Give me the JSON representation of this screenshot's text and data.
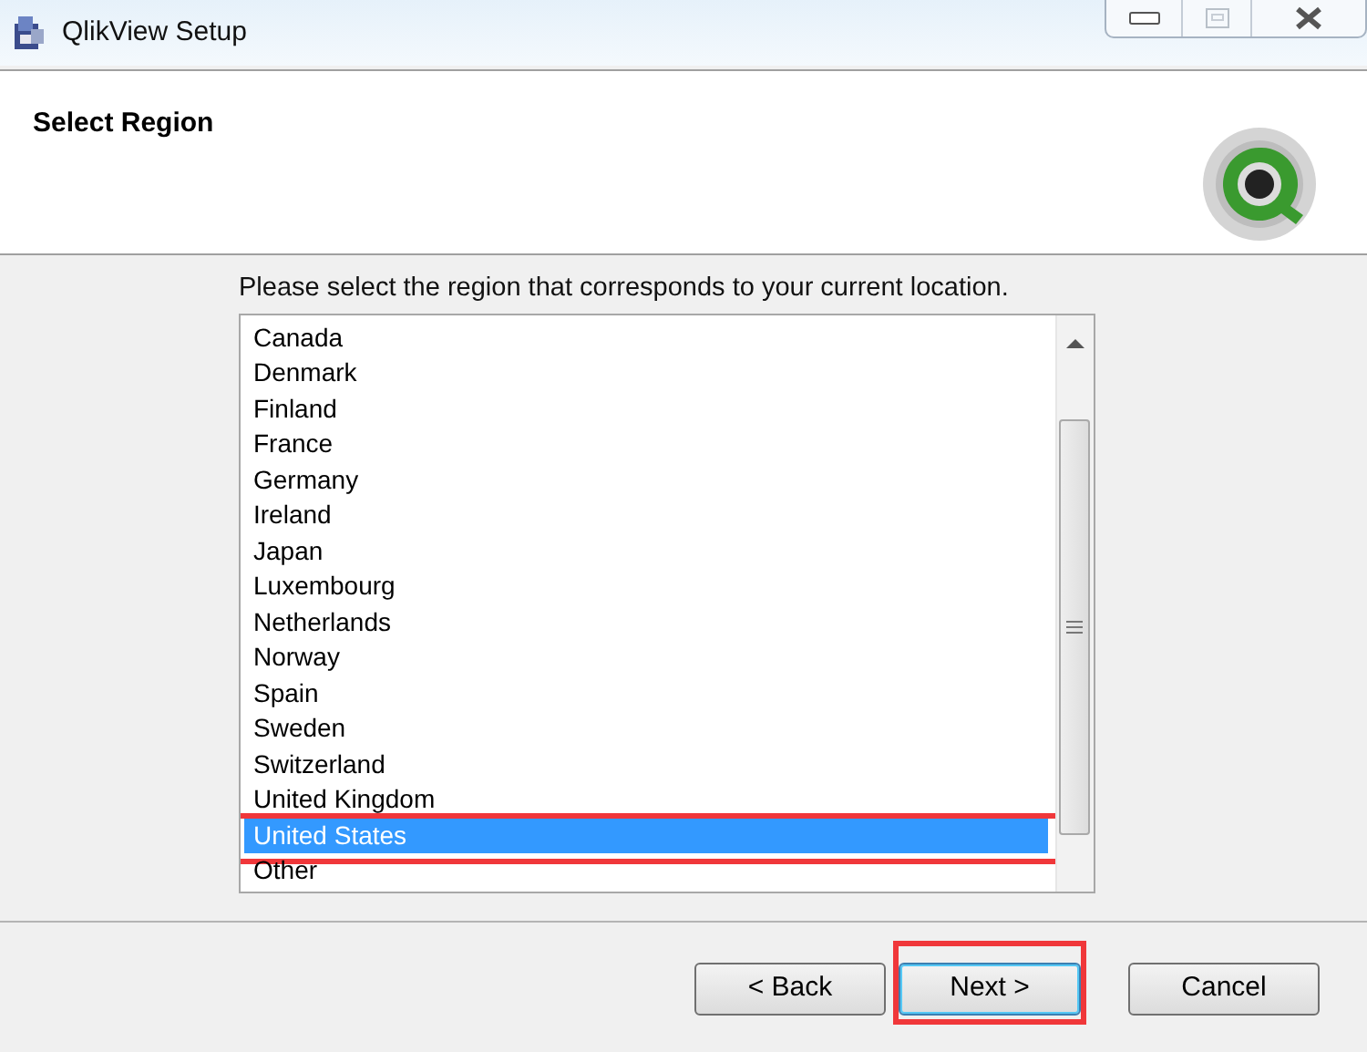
{
  "window": {
    "title": "QlikView Setup"
  },
  "header": {
    "title": "Select Region"
  },
  "instruction": "Please select the region that corresponds to your current location.",
  "regions": [
    {
      "label": "Canada",
      "selected": false,
      "annotated": false
    },
    {
      "label": "Denmark",
      "selected": false,
      "annotated": false
    },
    {
      "label": "Finland",
      "selected": false,
      "annotated": false
    },
    {
      "label": "France",
      "selected": false,
      "annotated": false
    },
    {
      "label": "Germany",
      "selected": false,
      "annotated": false
    },
    {
      "label": "Ireland",
      "selected": false,
      "annotated": false
    },
    {
      "label": "Japan",
      "selected": false,
      "annotated": false
    },
    {
      "label": "Luxembourg",
      "selected": false,
      "annotated": false
    },
    {
      "label": "Netherlands",
      "selected": false,
      "annotated": false
    },
    {
      "label": "Norway",
      "selected": false,
      "annotated": false
    },
    {
      "label": "Spain",
      "selected": false,
      "annotated": false
    },
    {
      "label": "Sweden",
      "selected": false,
      "annotated": false
    },
    {
      "label": "Switzerland",
      "selected": false,
      "annotated": false
    },
    {
      "label": "United Kingdom",
      "selected": false,
      "annotated": false
    },
    {
      "label": "United States",
      "selected": true,
      "annotated": true
    },
    {
      "label": "Other",
      "selected": false,
      "annotated": false
    }
  ],
  "buttons": [
    {
      "label": "< Back",
      "default": false,
      "annotated": false
    },
    {
      "label": "Next >",
      "default": true,
      "annotated": true
    },
    {
      "label": "Cancel",
      "default": false,
      "annotated": false
    }
  ]
}
